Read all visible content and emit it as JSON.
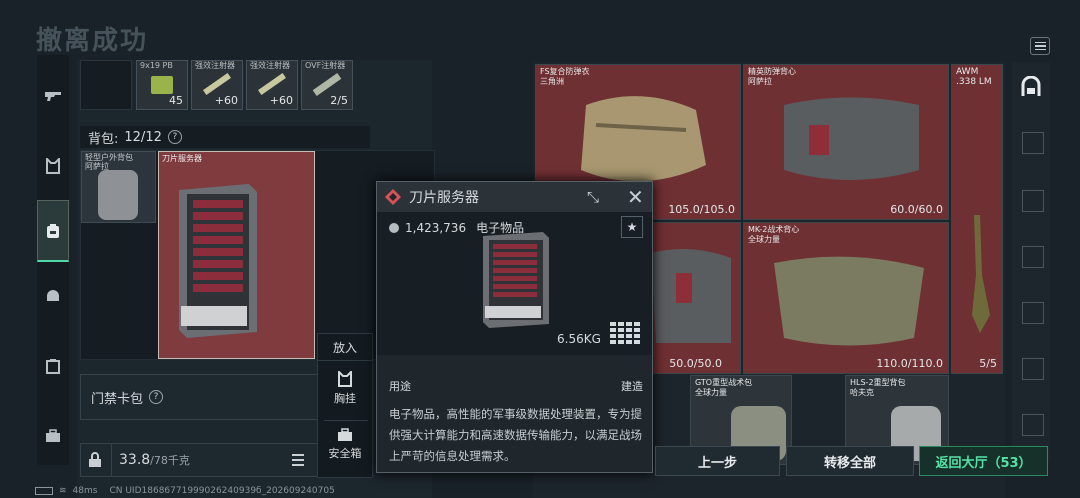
{
  "title": "撤离成功",
  "loadout_slots": [
    {
      "label": "9x19\nPB",
      "count": "45"
    },
    {
      "label": "强效注射器",
      "count": "+60"
    },
    {
      "label": "强效注射器",
      "count": "+60"
    },
    {
      "label": "OVF注射器",
      "count": "2/5"
    }
  ],
  "backpack": {
    "label": "背包:",
    "capacity": "12/12",
    "help": "?"
  },
  "backpack_items": [
    {
      "label": "轻型户外背包\n阿萨拉"
    },
    {
      "label": "刀片服务器"
    }
  ],
  "keycard_case": {
    "label": "门禁卡包",
    "help": "?"
  },
  "weight": {
    "value": "33.8",
    "max": "/78千克"
  },
  "context_menu": {
    "header": "放入",
    "items": [
      "胸挂",
      "安全箱"
    ]
  },
  "tooltip": {
    "name": "刀片服务器",
    "value": "1,423,736",
    "category": "电子物品",
    "weight": "6.56KG",
    "use_label": "用途",
    "use_value": "建造",
    "description": "电子物品，高性能的军事级数据处理装置，专为提供强大计算能力和高速数据传输能力，以满足战场上严苛的信息处理需求。"
  },
  "loot_items": [
    {
      "name": "FS复合防弹衣\n三角洲",
      "durability": "105.0/105.0"
    },
    {
      "name": "精英防弹背心\n阿萨拉",
      "durability": "60.0/60.0"
    },
    {
      "name": "AWM\n.338 LM",
      "durability": "5/5"
    },
    {
      "name": "",
      "durability": "50.0/50.0"
    },
    {
      "name": "MK-2战术背心\n全球力量",
      "durability": "110.0/110.0"
    },
    {
      "name": "GTO重型战术包\n全球力量",
      "durability": ""
    },
    {
      "name": "HLS-2重型背包\n哈夫克",
      "durability": ""
    }
  ],
  "buttons": {
    "prev": "上一步",
    "transfer_all": "转移全部",
    "return": "返回大厅（53）"
  },
  "status": {
    "ping": "48ms",
    "uid": "CN UID18686771999026240939б_202609240705"
  },
  "colors": {
    "accent": "#4fd9a9",
    "highlight_red": "#7f3b3e",
    "tooltip_icon": "#d9525a"
  }
}
